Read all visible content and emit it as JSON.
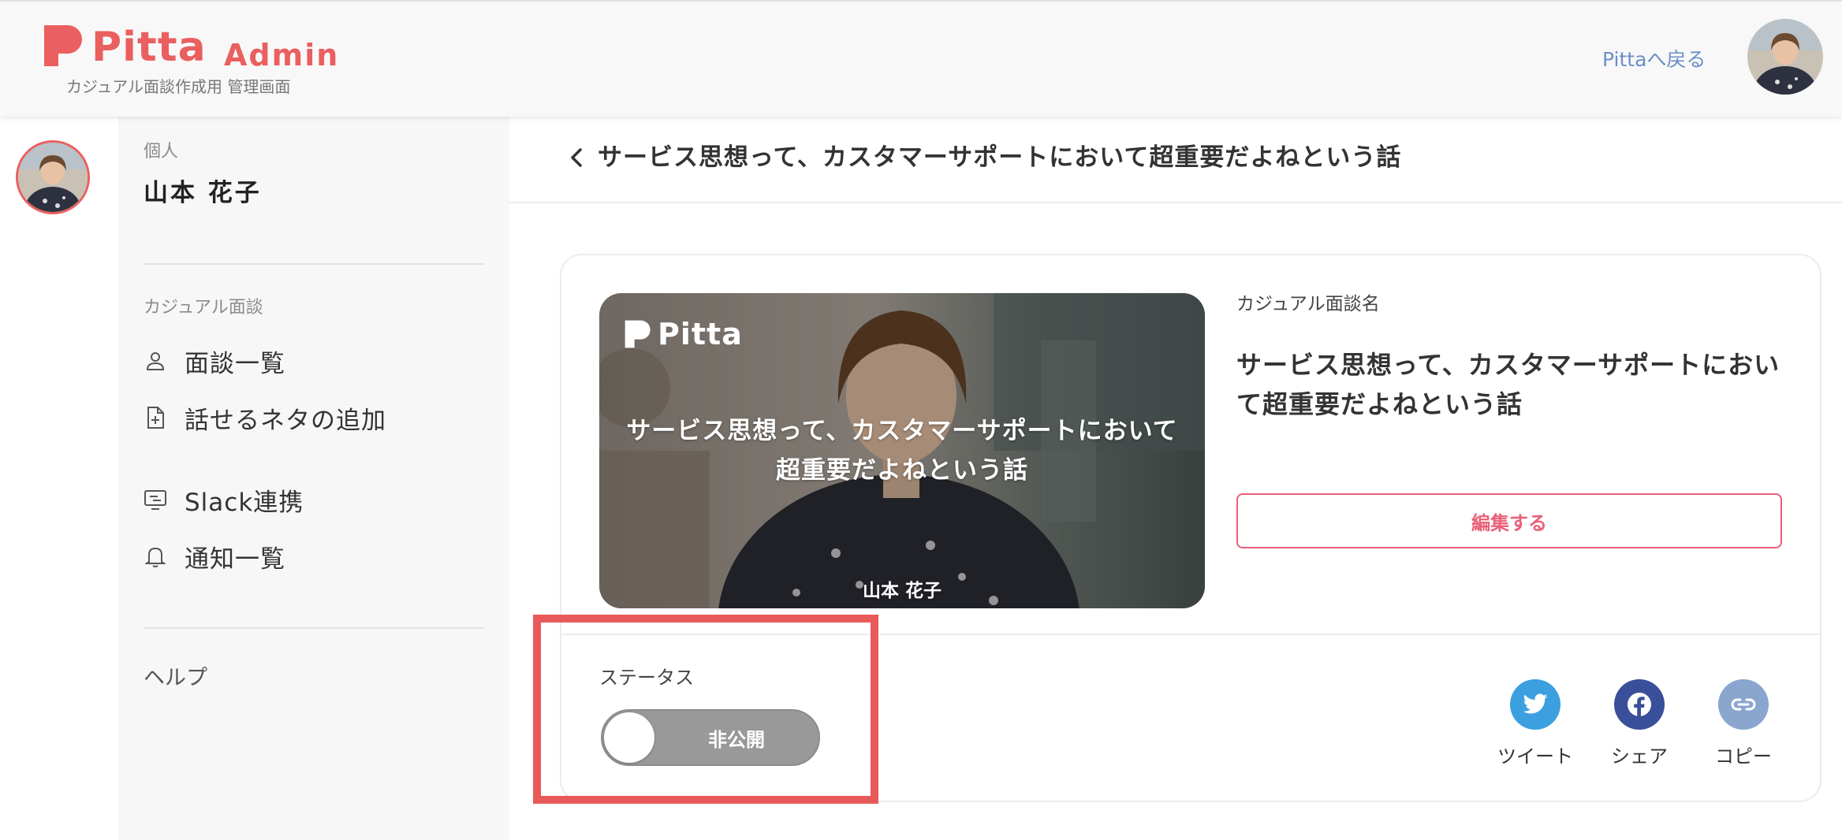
{
  "header": {
    "logo_word": "Pitta",
    "logo_admin": "Admin",
    "subtitle": "カジュアル面談作成用 管理画面",
    "back_link": "Pittaへ戻る"
  },
  "sidebar": {
    "profile_section_label": "個人",
    "profile_name": "山本 花子",
    "section_label": "カジュアル面談",
    "items": [
      {
        "label": "面談一覧",
        "icon": "person-icon"
      },
      {
        "label": "話せるネタの追加",
        "icon": "file-plus-icon"
      },
      {
        "label": "Slack連携",
        "icon": "slack-monitor-icon"
      },
      {
        "label": "通知一覧",
        "icon": "bell-icon"
      }
    ],
    "help": "ヘルプ"
  },
  "main": {
    "page_title": "サービス思想って、カスタマーサポートにおいて超重要だよねという話",
    "hero": {
      "logo_word": "Pitta",
      "title": "サービス思想って、カスタマーサポートにおいて超重要だよねという話",
      "name": "山本 花子"
    },
    "field_label": "カジュアル面談名",
    "field_value": "サービス思想って、カスタマーサポートにおいて超重要だよねという話",
    "edit_button": "編集する",
    "status_label": "ステータス",
    "status_toggle": {
      "label": "非公開",
      "on": false
    },
    "share": [
      {
        "label": "ツイート",
        "icon": "twitter-icon",
        "color": "#3c9fe0"
      },
      {
        "label": "シェア",
        "icon": "facebook-icon",
        "color": "#3a4f99"
      },
      {
        "label": "コピー",
        "icon": "link-icon",
        "color": "#8aa6cf"
      }
    ]
  },
  "colors": {
    "brand": "#ea5f5f",
    "accent_pink": "#ea5f77",
    "link_blue": "#6b8fc7",
    "toggle_off": "#999999",
    "highlight": "#e85a5a"
  }
}
